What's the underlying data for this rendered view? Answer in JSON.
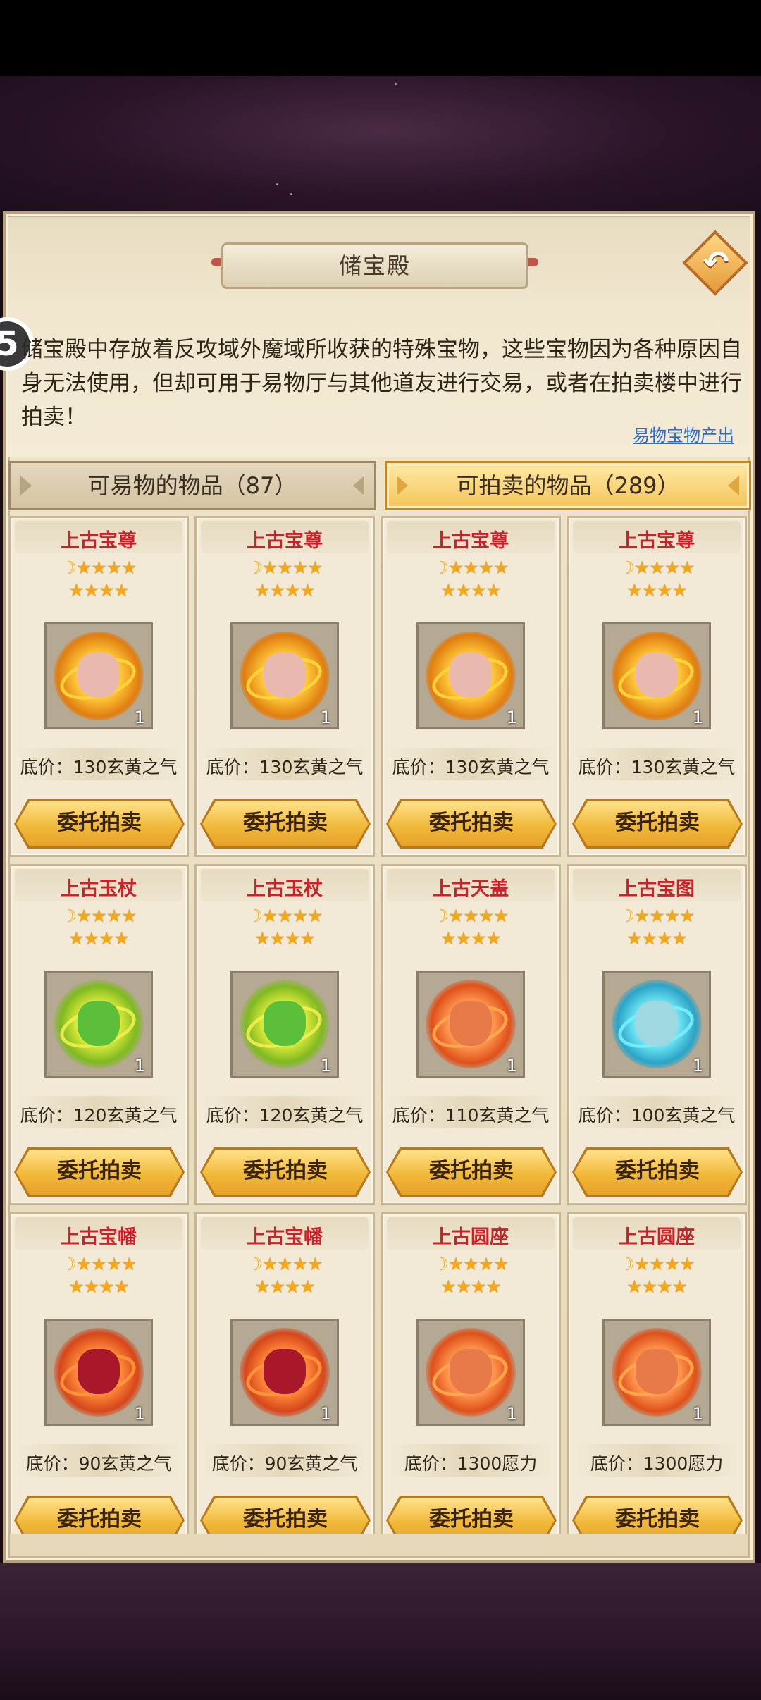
{
  "panel": {
    "title": "储宝殿",
    "back_icon": "back-arrow-icon",
    "badge": "5",
    "description": "储宝殿中存放着反攻域外魔域所收获的特殊宝物，这些宝物因为各种原因自身无法使用，但却可用于易物厅与其他道友进行交易，或者在拍卖楼中进行拍卖！",
    "link": "易物宝物产出"
  },
  "tabs": [
    {
      "label": "可易物的物品（87）",
      "active": false
    },
    {
      "label": "可拍卖的物品（289）",
      "active": true
    }
  ],
  "colors": {
    "item_name": "#c8232a",
    "star": "#f5a817",
    "button": "#f1b93a",
    "accent_tab": "#f4c55a"
  },
  "items": [
    {
      "name": "上古宝尊",
      "moons": "🌙",
      "stars1": "★★★★",
      "stars2": "★★★★",
      "qty": "1",
      "price": "底价：130玄黄之气",
      "button": "委托拍卖",
      "art": "gold"
    },
    {
      "name": "上古宝尊",
      "moons": "🌙",
      "stars1": "★★★★",
      "stars2": "★★★★",
      "qty": "1",
      "price": "底价：130玄黄之气",
      "button": "委托拍卖",
      "art": "gold"
    },
    {
      "name": "上古宝尊",
      "moons": "🌙",
      "stars1": "★★★★",
      "stars2": "★★★★",
      "qty": "1",
      "price": "底价：130玄黄之气",
      "button": "委托拍卖",
      "art": "gold"
    },
    {
      "name": "上古宝尊",
      "moons": "🌙",
      "stars1": "★★★★",
      "stars2": "★★★★",
      "qty": "1",
      "price": "底价：130玄黄之气",
      "button": "委托拍卖",
      "art": "gold"
    },
    {
      "name": "上古玉杖",
      "moons": "🌙",
      "stars1": "★★★★",
      "stars2": "★★★★",
      "qty": "1",
      "price": "底价：120玄黄之气",
      "button": "委托拍卖",
      "art": "green"
    },
    {
      "name": "上古玉杖",
      "moons": "🌙",
      "stars1": "★★★★",
      "stars2": "★★★★",
      "qty": "1",
      "price": "底价：120玄黄之气",
      "button": "委托拍卖",
      "art": "green"
    },
    {
      "name": "上古天盖",
      "moons": "🌙",
      "stars1": "★★★★",
      "stars2": "★★★★",
      "qty": "1",
      "price": "底价：110玄黄之气",
      "button": "委托拍卖",
      "art": "orange"
    },
    {
      "name": "上古宝图",
      "moons": "🌙",
      "stars1": "★★★★",
      "stars2": "★★★★",
      "qty": "1",
      "price": "底价：100玄黄之气",
      "button": "委托拍卖",
      "art": "cyan"
    },
    {
      "name": "上古宝幡",
      "moons": "🌙",
      "stars1": "★★★★",
      "stars2": "★★★★",
      "qty": "1",
      "price": "底价：90玄黄之气",
      "button": "委托拍卖",
      "art": "red"
    },
    {
      "name": "上古宝幡",
      "moons": "🌙",
      "stars1": "★★★★",
      "stars2": "★★★★",
      "qty": "1",
      "price": "底价：90玄黄之气",
      "button": "委托拍卖",
      "art": "red"
    },
    {
      "name": "上古圆座",
      "moons": "🌙",
      "stars1": "★★★★",
      "stars2": "★★★★",
      "qty": "1",
      "price": "底价：1300愿力",
      "button": "委托拍卖",
      "art": "orange"
    },
    {
      "name": "上古圆座",
      "moons": "🌙",
      "stars1": "★★★★",
      "stars2": "★★★★",
      "qty": "1",
      "price": "底价：1300愿力",
      "button": "委托拍卖",
      "art": "orange"
    }
  ]
}
